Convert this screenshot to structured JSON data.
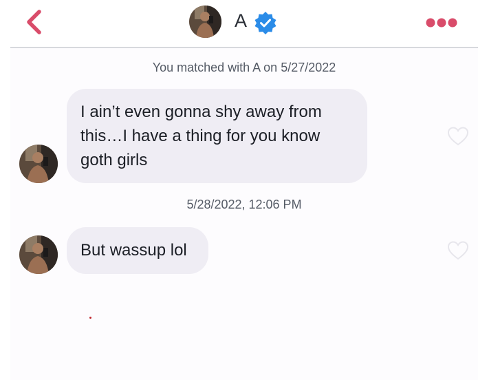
{
  "header": {
    "back_icon": "chevron-left-icon",
    "name": "A",
    "verified_icon": "verified-badge-icon",
    "more_icon": "more-dots-icon",
    "accent_color": "#d94c6a",
    "verified_color": "#2b8ce8"
  },
  "chat": {
    "match_notice": "You matched with A on 5/27/2022",
    "messages": [
      {
        "lines": [
          "I ain’t even gonna shy away from",
          "this…I have a thing for you know",
          "goth girls"
        ],
        "liked": false
      },
      {
        "timestamp": "5/28/2022, 12:06 PM"
      },
      {
        "lines": [
          "But wassup lol"
        ],
        "liked": false
      }
    ]
  }
}
